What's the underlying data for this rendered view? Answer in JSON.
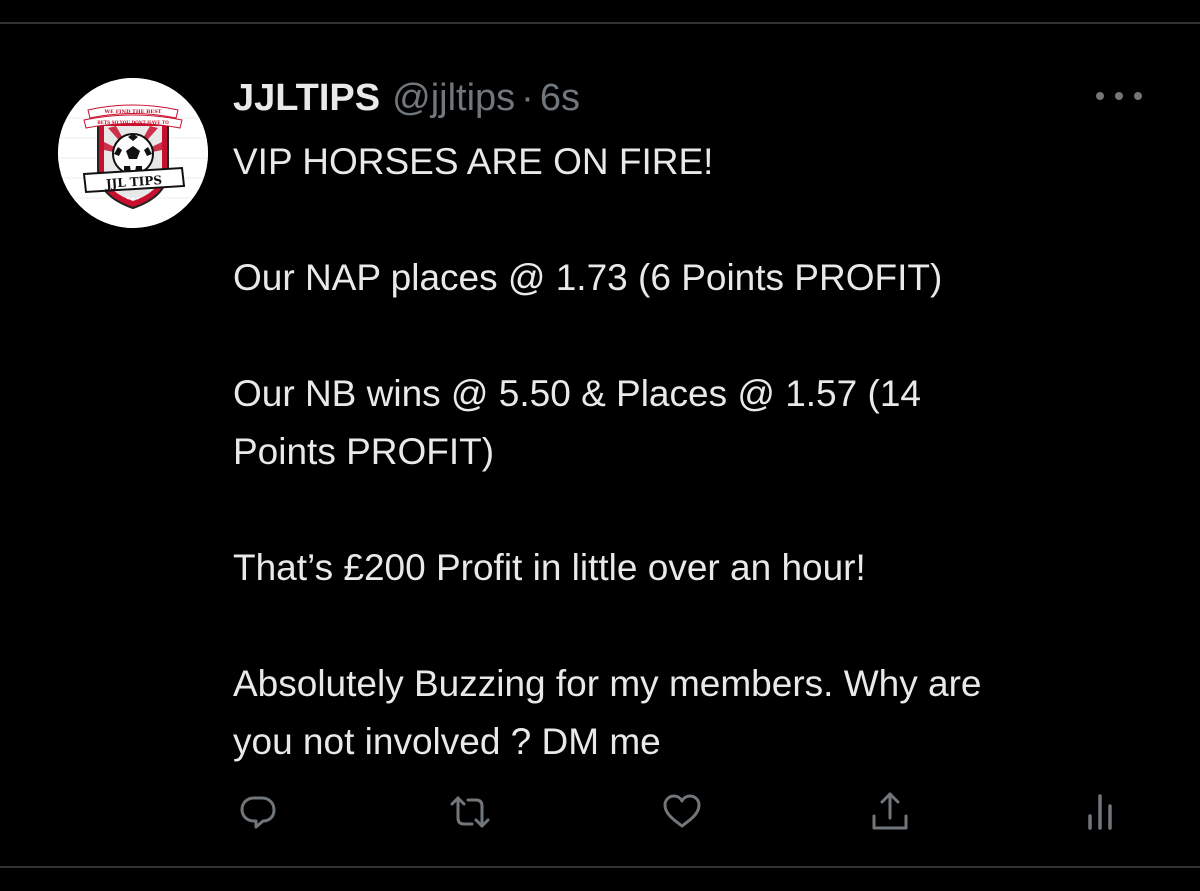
{
  "tweet": {
    "display_name": "JJLTIPS",
    "handle": "@jjltips",
    "separator": "·",
    "time": "6s",
    "avatar": {
      "banner_top": "WE FIND THE BEST",
      "banner_bottom": "BETS SO YOU DONT HAVE TO",
      "badge": "JJL TIPS"
    },
    "text_lines": [
      "VIP HORSES ARE ON FIRE!",
      "",
      "Our NAP places @ 1.73 (6 Points PROFIT)",
      "",
      "Our NB wins @ 5.50 & Places @ 1.57 (14",
      "Points PROFIT)",
      "",
      "That’s £200 Profit in little over an hour!",
      "",
      "Absolutely Buzzing for my members. Why are",
      "you not involved ? DM me"
    ]
  },
  "icons": {
    "more": "more-icon",
    "reply": "reply-icon",
    "retweet": "retweet-icon",
    "like": "heart-icon",
    "share": "share-icon",
    "analytics": "analytics-icon"
  },
  "colors": {
    "background": "#000000",
    "text": "#e7e9ea",
    "secondary": "#71767b",
    "divider": "#2f3336",
    "brand_red": "#c8102e"
  }
}
